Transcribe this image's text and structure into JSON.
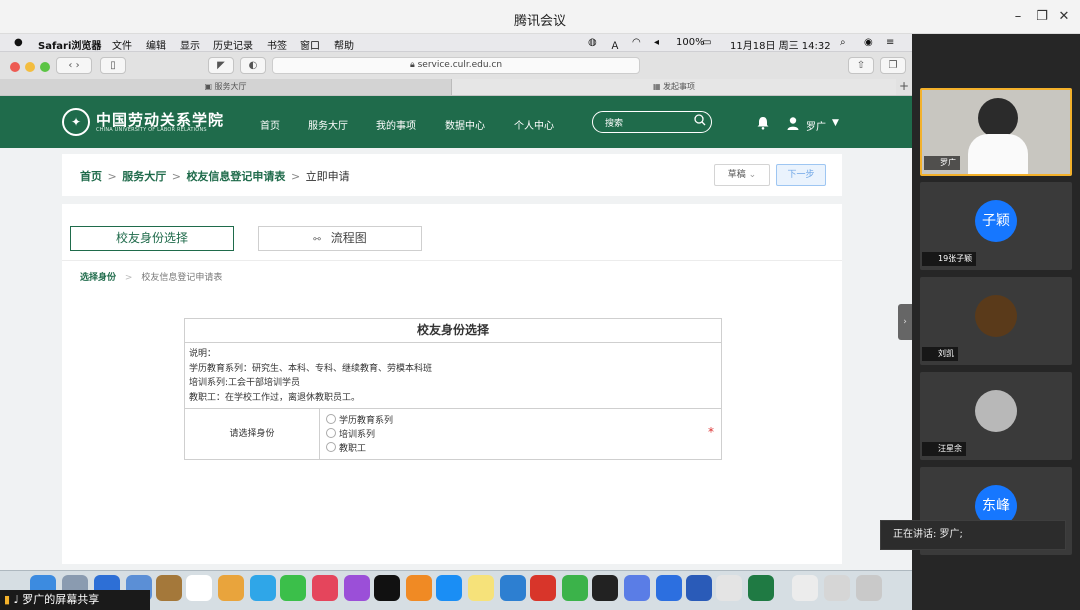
{
  "meeting": {
    "title": "腾讯会议",
    "share_label": "罗广的屏幕共享",
    "speaking": "正在讲话: 罗广;"
  },
  "mac_menu": {
    "app": "Safari浏览器",
    "items": [
      "文件",
      "编辑",
      "显示",
      "历史记录",
      "书签",
      "窗口",
      "帮助"
    ],
    "battery": "100%",
    "datetime": "11月18日 周三  14:32"
  },
  "safari": {
    "url": "service.culr.edu.cn",
    "tabs": [
      "服务大厅",
      "发起事项"
    ]
  },
  "site": {
    "name": "中国劳动关系学院",
    "subtitle": "CHINA UNIVERSITY OF LABOR RELATIONS",
    "nav": [
      "首页",
      "服务大厅",
      "我的事项",
      "数据中心",
      "个人中心"
    ],
    "search_placeholder": "搜索",
    "user": "罗广"
  },
  "breadcrumb": {
    "home": "首页",
    "hall": "服务大厅",
    "form": "校友信息登记申请表",
    "current": "立即申请",
    "sep": ">"
  },
  "actions": {
    "draft": "草稿",
    "next": "下一步"
  },
  "tabs": {
    "identity": "校友身份选择",
    "flow": "流程图"
  },
  "steps": {
    "step1": "选择身份",
    "step2": "校友信息登记申请表",
    "sep": ">"
  },
  "form": {
    "title": "校友身份选择",
    "desc": [
      "说明：",
      "学历教育系列：研究生、本科、专科、继续教育、劳模本科班",
      "培训系列:工会干部培训学员",
      "教职工：在学校工作过，离退休教职员工。"
    ],
    "select_label": "请选择身份",
    "options": [
      "学历教育系列",
      "培训系列",
      "教职工"
    ],
    "required_mark": "*"
  },
  "participants": [
    {
      "name": "罗广",
      "avatar": ""
    },
    {
      "name": "19张子颖",
      "avatar": "子颖"
    },
    {
      "name": "刘凯",
      "avatar": ""
    },
    {
      "name": "汪星余",
      "avatar": ""
    },
    {
      "name": "",
      "avatar": "东峰"
    }
  ],
  "colors": {
    "brand": "#1f6b4b",
    "accent": "#1677ff",
    "required": "#d33333"
  }
}
